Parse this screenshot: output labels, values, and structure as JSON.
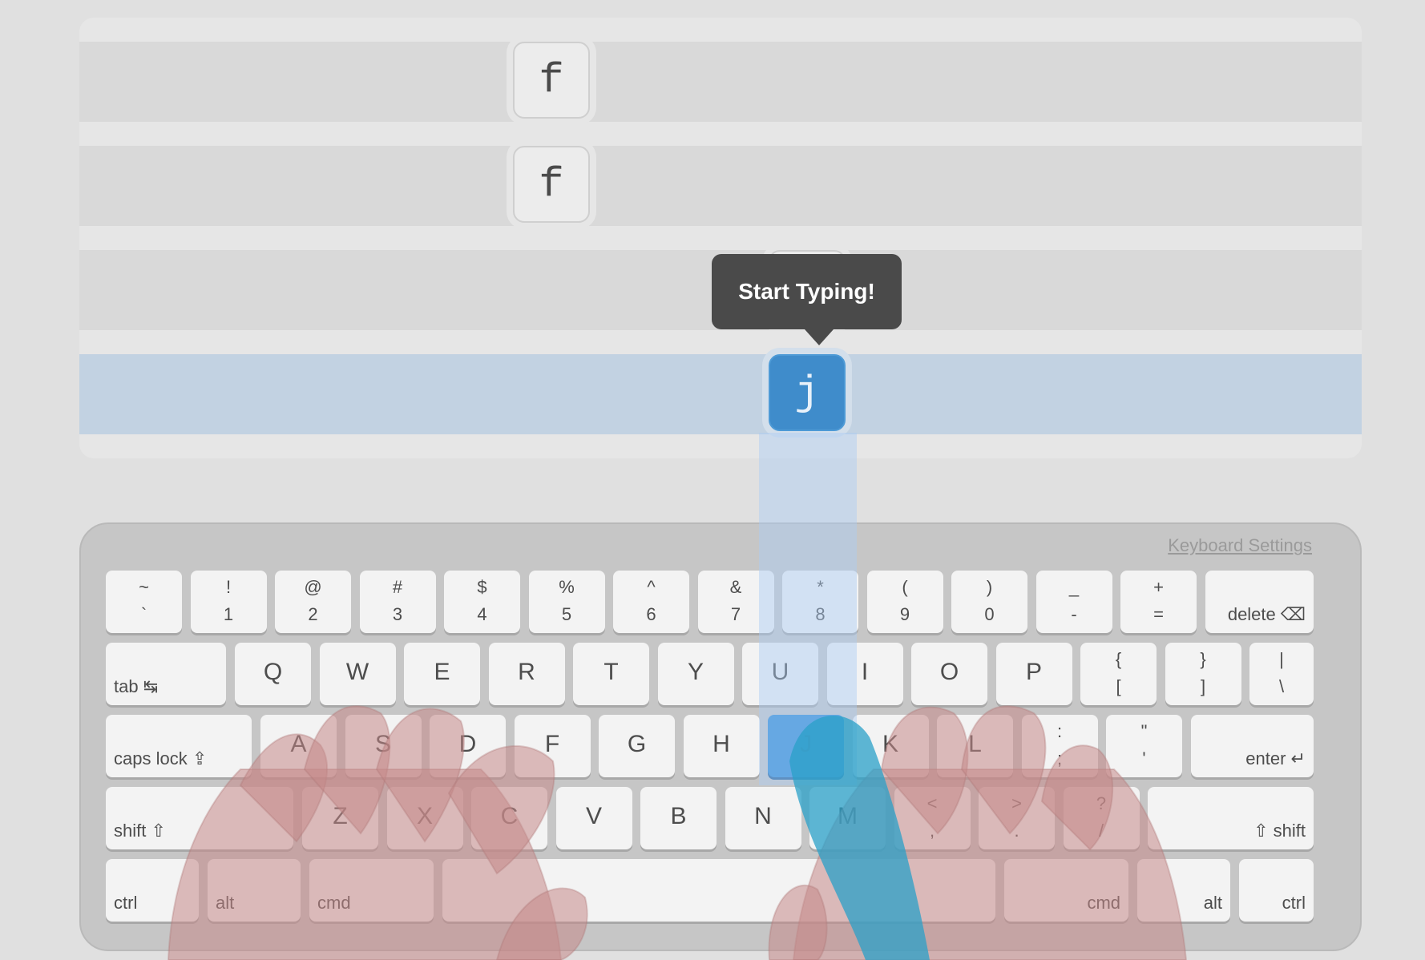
{
  "lesson": {
    "rows": [
      {
        "keys": [
          {
            "char": "f",
            "state": "done"
          }
        ]
      },
      {
        "keys": [
          {
            "char": "f",
            "state": "done"
          }
        ]
      },
      {
        "keys": [
          {
            "char": "j",
            "state": "pending"
          }
        ]
      },
      {
        "keys": [
          {
            "char": "j",
            "state": "current"
          }
        ]
      }
    ],
    "tooltip": "Start Typing!"
  },
  "keyboard": {
    "settings_link": "Keyboard Settings",
    "highlight_key": "J",
    "highlight_color": "#2f8bd6",
    "rows": {
      "number": [
        [
          "~",
          "`"
        ],
        [
          "!",
          "1"
        ],
        [
          "@",
          "2"
        ],
        [
          "#",
          "3"
        ],
        [
          "$",
          "4"
        ],
        [
          "%",
          "5"
        ],
        [
          "^",
          "6"
        ],
        [
          "&",
          "7"
        ],
        [
          "*",
          "8"
        ],
        [
          "(",
          "9"
        ],
        [
          ")",
          "0"
        ],
        [
          "_",
          "-"
        ],
        [
          "+",
          "="
        ]
      ],
      "delete": "delete ⌫",
      "tab": "tab ↹",
      "top": [
        "Q",
        "W",
        "E",
        "R",
        "T",
        "Y",
        "U",
        "I",
        "O",
        "P"
      ],
      "top_punct": [
        [
          "{",
          "["
        ],
        [
          "}",
          "]"
        ],
        [
          "|",
          "\\"
        ]
      ],
      "caps": "caps lock ⇪",
      "home": [
        "A",
        "S",
        "D",
        "F",
        "G",
        "H",
        "J",
        "K",
        "L"
      ],
      "home_punct": [
        [
          ":",
          ";"
        ],
        [
          "\"",
          "'"
        ]
      ],
      "enter": "enter ↵",
      "shift_left": "shift ⇧",
      "bottom": [
        "Z",
        "X",
        "C",
        "V",
        "B",
        "N",
        "M"
      ],
      "bottom_punct": [
        [
          "<",
          ","
        ],
        [
          ">",
          "."
        ],
        [
          "?",
          "/"
        ]
      ],
      "shift_right": "⇧ shift",
      "modifiers_left": [
        "ctrl",
        "alt",
        "cmd"
      ],
      "modifiers_right": [
        "cmd",
        "alt",
        "ctrl"
      ]
    }
  },
  "hands": {
    "guide_finger": "right-index",
    "guide_finger_color": "#2aa0c8",
    "hand_color": "#c48888"
  }
}
